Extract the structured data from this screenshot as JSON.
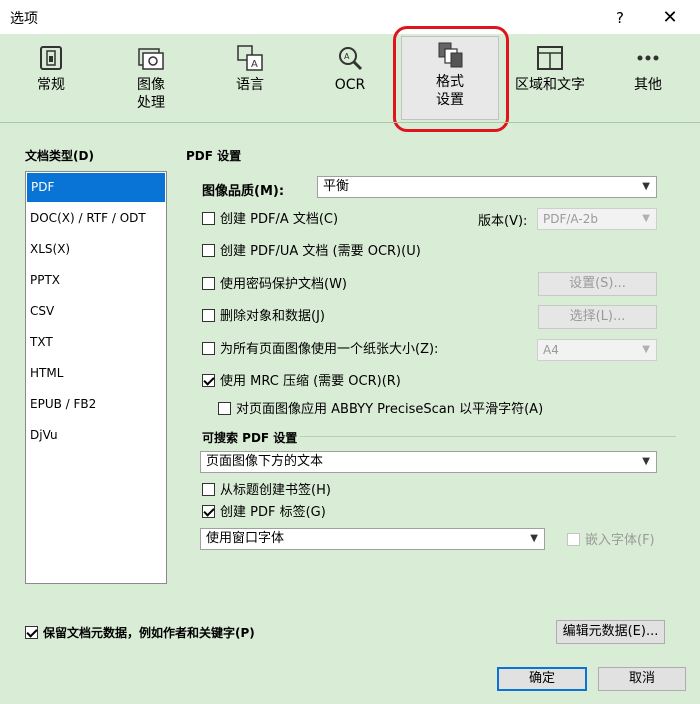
{
  "window": {
    "title": "选项",
    "help_label": "?",
    "close_label": "✕"
  },
  "toolbar": {
    "items": [
      {
        "label": "常规",
        "icon": "general-icon"
      },
      {
        "label": "图像\n处理",
        "icon": "image-processing-icon"
      },
      {
        "label": "语言",
        "icon": "language-icon"
      },
      {
        "label": "OCR",
        "icon": "ocr-icon"
      },
      {
        "label": "格式\n设置",
        "icon": "format-settings-icon",
        "active": true
      },
      {
        "label": "区域和文字",
        "icon": "areas-text-icon"
      },
      {
        "label": "其他",
        "icon": "more-icon"
      }
    ],
    "highlight_color": "#e0141c"
  },
  "doc_types": {
    "heading": "文档类型(D)",
    "items": [
      "PDF",
      "DOC(X) / RTF / ODT",
      "XLS(X)",
      "PPTX",
      "CSV",
      "TXT",
      "HTML",
      "EPUB / FB2",
      "DjVu"
    ],
    "selected": "PDF"
  },
  "pdf": {
    "heading": "PDF 设置",
    "image_quality_label": "图像品质(M):",
    "image_quality_value": "平衡",
    "create_pdfa_label": "创建 PDF/A 文档(C)",
    "version_label": "版本(V):",
    "version_value": "PDF/A-2b",
    "create_pdfua_label": "创建 PDF/UA 文档 (需要 OCR)(U)",
    "password_label": "使用密码保护文档(W)",
    "settings_button": "设置(S)...",
    "delete_objects_label": "删除对象和数据(J)",
    "select_button": "选择(L)...",
    "paper_size_label": "为所有页面图像使用一个纸张大小(Z):",
    "paper_size_value": "A4",
    "mrc_label": "使用 MRC 压缩 (需要 OCR)(R)",
    "precisescan_label": "对页面图像应用 ABBYY PreciseScan 以平滑字符(A)"
  },
  "searchable": {
    "heading": "可搜索 PDF 设置",
    "mode_value": "页面图像下方的文本",
    "bookmarks_label": "从标题创建书签(H)",
    "tags_label": "创建 PDF 标签(G)",
    "font_value": "使用窗口字体",
    "embed_fonts_label": "嵌入字体(F)"
  },
  "footer": {
    "keep_metadata_label": "保留文档元数据，例如作者和关键字(P)",
    "edit_metadata_button": "编辑元数据(E)...",
    "ok_button": "确定",
    "cancel_button": "取消"
  }
}
